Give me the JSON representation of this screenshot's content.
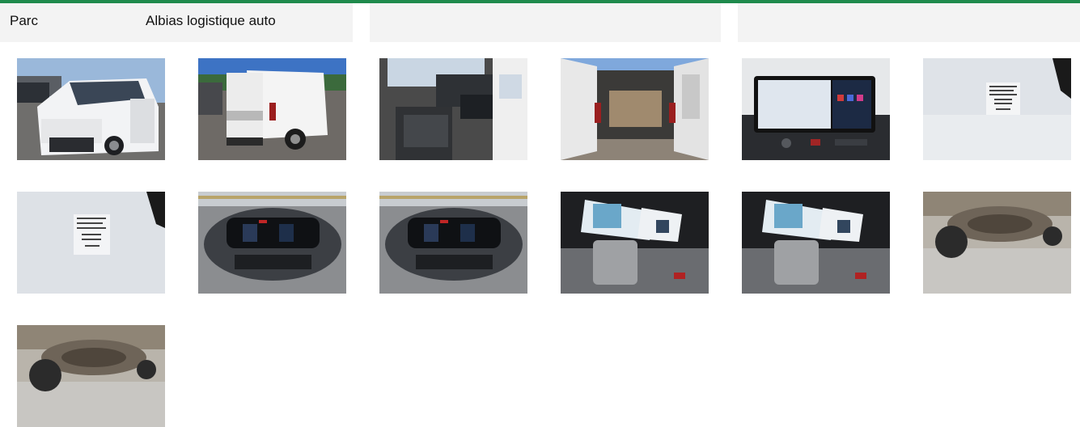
{
  "header": {
    "park_label": "Parc",
    "park_value": "Albias logistique auto"
  },
  "colors": {
    "accent": "#1f8a4c",
    "header_bg": "#f3f3f3"
  },
  "gallery": [
    {
      "subject": "van-front-exterior"
    },
    {
      "subject": "van-rear-exterior"
    },
    {
      "subject": "van-interior-cabin"
    },
    {
      "subject": "van-open-rear-cargo"
    },
    {
      "subject": "infotainment-screen"
    },
    {
      "subject": "door-sticker-label"
    },
    {
      "subject": "door-sticker-label"
    },
    {
      "subject": "instrument-cluster"
    },
    {
      "subject": "instrument-cluster"
    },
    {
      "subject": "manuals-on-seat"
    },
    {
      "subject": "manuals-on-seat"
    },
    {
      "subject": "spare-wheel-underside"
    },
    {
      "subject": "spare-wheel-underside"
    }
  ]
}
